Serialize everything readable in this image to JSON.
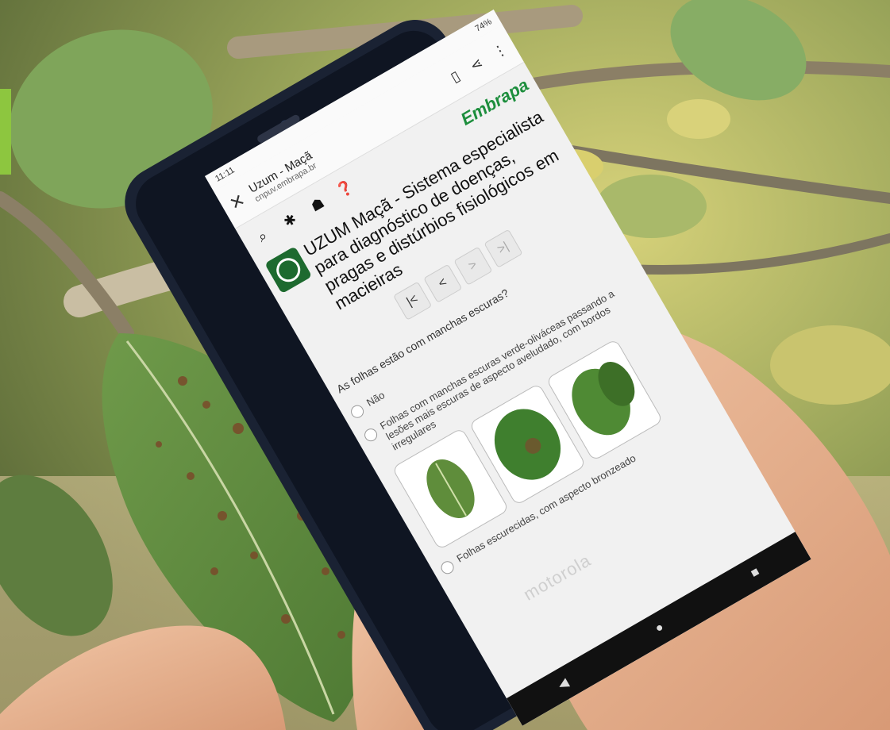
{
  "browser": {
    "time": "11:11",
    "battery": "74%",
    "page_title": "Uzum - Maçã",
    "url": "cnpuv.embrapa.br"
  },
  "toolbar": {
    "brand_prefix": "Emb",
    "brand_suffix": "rapa"
  },
  "app": {
    "title": "UZUM Maçã - Sistema especialista para diagnóstico de doenças, pragas e distúrbios fisiológicos em macieiras"
  },
  "nav": {
    "first": "|<",
    "prev": "<",
    "next": ">",
    "last": ">|"
  },
  "question": "As folhas estão com manchas escuras?",
  "options": [
    {
      "label": "Não"
    },
    {
      "label": "Folhas com manchas escuras verde-oliváceas passando a lesões mais escuras de aspecto aveludado, com bordos irregulares"
    },
    {
      "label": "Folhas escurecidas, com aspecto bronzeado"
    }
  ],
  "device_brand": "motorola",
  "colors": {
    "brand_blue": "#1b6fb5",
    "brand_green": "#1d8e3d",
    "logo_green": "#1d6a2f",
    "corner_tab": "#8dc63f"
  }
}
